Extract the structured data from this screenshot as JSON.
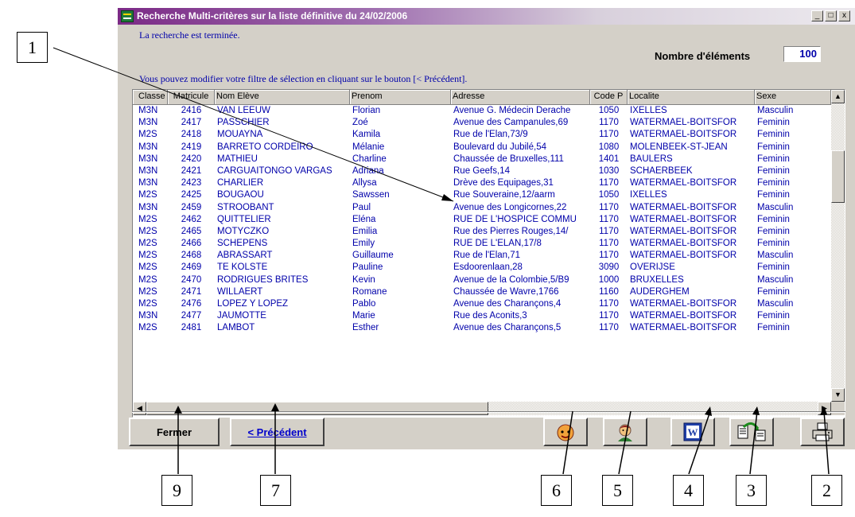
{
  "window": {
    "title": "Recherche Multi-critères sur la liste définitive du 24/02/2006",
    "controls": [
      "_",
      "□",
      "x"
    ]
  },
  "status": {
    "message": "La recherche est terminée.",
    "hint": "Vous pouvez modifier votre filtre de sélection en cliquant sur le bouton [< Précédent].",
    "count_label": "Nombre d'éléments",
    "count_value": "100"
  },
  "table": {
    "columns": [
      "Classe",
      "Matricule",
      "Nom Elève",
      "Prenom",
      "Adresse",
      "Code P",
      "Localite",
      "Sexe"
    ],
    "rows": [
      [
        "M3N",
        "2416",
        "VAN LEEUW",
        "Florian",
        "Avenue G. Médecin Derache",
        "1050",
        "IXELLES",
        "Masculin"
      ],
      [
        "M3N",
        "2417",
        "PASSCHIER",
        "Zoé",
        "Avenue des Campanules,69",
        "1170",
        "WATERMAEL-BOITSFOR",
        "Feminin"
      ],
      [
        "M2S",
        "2418",
        "MOUAYNA",
        "Kamila",
        "Rue de l'Elan,73/9",
        "1170",
        "WATERMAEL-BOITSFOR",
        "Feminin"
      ],
      [
        "M3N",
        "2419",
        "BARRETO CORDEIRO",
        "Mélanie",
        "Boulevard du Jubilé,54",
        "1080",
        "MOLENBEEK-ST-JEAN",
        "Feminin"
      ],
      [
        "M3N",
        "2420",
        "MATHIEU",
        "Charline",
        "Chaussée de Bruxelles,111",
        "1401",
        "BAULERS",
        "Feminin"
      ],
      [
        "M3N",
        "2421",
        "CARGUAITONGO VARGAS",
        "Adriana",
        "Rue Geefs,14",
        "1030",
        "SCHAERBEEK",
        "Feminin"
      ],
      [
        "M3N",
        "2423",
        "CHARLIER",
        "Allysa",
        "Drève des Equipages,31",
        "1170",
        "WATERMAEL-BOITSFOR",
        "Feminin"
      ],
      [
        "M2S",
        "2425",
        "BOUGAOU",
        "Sawssen",
        "Rue Souveraine,12/aarm",
        "1050",
        "IXELLES",
        "Feminin"
      ],
      [
        "M3N",
        "2459",
        "STROOBANT",
        "Paul",
        "Avenue des Longicornes,22",
        "1170",
        "WATERMAEL-BOITSFOR",
        "Masculin"
      ],
      [
        "M2S",
        "2462",
        "QUITTELIER",
        "Eléna",
        "RUE DE L'HOSPICE COMMU",
        "1170",
        "WATERMAEL-BOITSFOR",
        "Feminin"
      ],
      [
        "M2S",
        "2465",
        "MOTYCZKO",
        "Emilia",
        "Rue des Pierres Rouges,14/",
        "1170",
        "WATERMAEL-BOITSFOR",
        "Feminin"
      ],
      [
        "M2S",
        "2466",
        "SCHEPENS",
        "Emily",
        "RUE DE L'ELAN,17/8",
        "1170",
        "WATERMAEL-BOITSFOR",
        "Feminin"
      ],
      [
        "M2S",
        "2468",
        "ABRASSART",
        "Guillaume",
        "Rue de l'Elan,71",
        "1170",
        "WATERMAEL-BOITSFOR",
        "Masculin"
      ],
      [
        "M2S",
        "2469",
        "TE KOLSTE",
        "Pauline",
        "Esdoorenlaan,28",
        "3090",
        "OVERIJSE",
        "Feminin"
      ],
      [
        "M2S",
        "2470",
        "RODRIGUES BRITES",
        "Kevin",
        "Avenue de la Colombie,5/B9",
        "1000",
        "BRUXELLES",
        "Masculin"
      ],
      [
        "M2S",
        "2471",
        "WILLAERT",
        "Romane",
        "Chaussée de Wavre,1766",
        "1160",
        "AUDERGHEM",
        "Feminin"
      ],
      [
        "M2S",
        "2476",
        "LOPEZ Y LOPEZ",
        "Pablo",
        "Avenue des Charançons,4",
        "1170",
        "WATERMAEL-BOITSFOR",
        "Masculin"
      ],
      [
        "M3N",
        "2477",
        "JAUMOTTE",
        "Marie",
        "Rue des Aconits,3",
        "1170",
        "WATERMAEL-BOITSFOR",
        "Feminin"
      ],
      [
        "M2S",
        "2481",
        "LAMBOT",
        "Esther",
        "Avenue des Charançons,5",
        "1170",
        "WATERMAEL-BOITSFOR",
        "Feminin"
      ]
    ]
  },
  "buttons": {
    "close_label": "Fermer",
    "previous_label": "< Précédent",
    "icons": [
      "face-red-icon",
      "face-user-icon",
      "word-export-icon",
      "copy-export-icon",
      "printer-icon"
    ]
  },
  "callouts": [
    "1",
    "9",
    "7",
    "6",
    "5",
    "4",
    "3",
    "2"
  ],
  "colors": {
    "title_gradient_start": "#7b2a86",
    "window_bg": "#d4d0c8",
    "text_blue": "#0000aa"
  }
}
